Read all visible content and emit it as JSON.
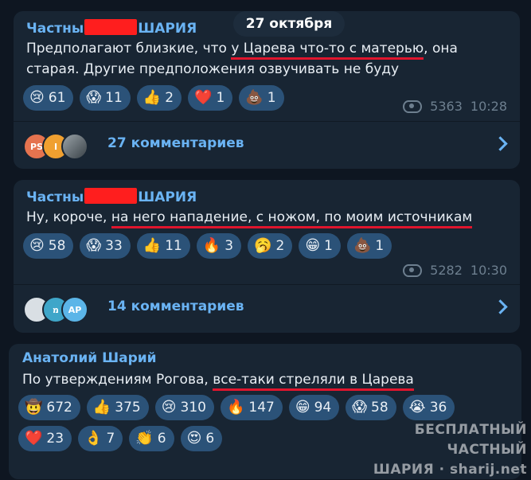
{
  "date_pill": "27 октября",
  "posts": [
    {
      "author_pre": "Частны",
      "author_post": "ШАРИЯ",
      "text_line1_pre": "Предполагают близкие, что ",
      "text_line1_ul": "у Царева что-то с матерью",
      "text_line1_post": ", она",
      "text_line2": "старая. Другие предположения озвучивать не буду",
      "reactions": [
        {
          "icon": "crying-face",
          "emoji": "😢",
          "count": "61"
        },
        {
          "icon": "screaming-face",
          "emoji": "😱",
          "count": "11"
        },
        {
          "icon": "thumbs-up",
          "emoji": "👍",
          "count": "2"
        },
        {
          "icon": "red-heart",
          "emoji": "❤️",
          "count": "1"
        },
        {
          "icon": "pile-of-poo",
          "emoji": "💩",
          "count": "1"
        }
      ],
      "views": "5363",
      "time": "10:28",
      "avatars": [
        "PS",
        "I",
        ""
      ],
      "comments": "27 комментариев"
    },
    {
      "author_pre": "Частны",
      "author_post": "ШАРИЯ",
      "text_line1_pre": "Ну, короче, ",
      "text_line1_ul": "на него нападение, с ножом, по моим источникам",
      "reactions": [
        {
          "icon": "crying-face",
          "emoji": "😢",
          "count": "58"
        },
        {
          "icon": "screaming-face",
          "emoji": "😱",
          "count": "33"
        },
        {
          "icon": "thumbs-up",
          "emoji": "👍",
          "count": "11"
        },
        {
          "icon": "fire",
          "emoji": "🔥",
          "count": "3"
        },
        {
          "icon": "yawning-face",
          "emoji": "🥱",
          "count": "2"
        },
        {
          "icon": "grinning-face",
          "emoji": "😁",
          "count": "1"
        },
        {
          "icon": "pile-of-poo",
          "emoji": "💩",
          "count": "1"
        }
      ],
      "views": "5282",
      "time": "10:30",
      "avatars": [
        "",
        "מ",
        "AP"
      ],
      "comments": "14 комментариев"
    },
    {
      "author": "Анатолий Шарий",
      "text_line1_pre": "По утверждениям Рогова, ",
      "text_line1_ul": "все-таки стреляли в Царева",
      "reactions_row1": [
        {
          "icon": "cowboy-face",
          "emoji": "🤠",
          "count": "672"
        },
        {
          "icon": "thumbs-up",
          "emoji": "👍",
          "count": "375"
        },
        {
          "icon": "crying-face",
          "emoji": "😢",
          "count": "310"
        },
        {
          "icon": "fire",
          "emoji": "🔥",
          "count": "147"
        },
        {
          "icon": "grinning-face",
          "emoji": "😁",
          "count": "94"
        },
        {
          "icon": "screaming-face",
          "emoji": "😱",
          "count": "58"
        },
        {
          "icon": "loudly-crying-face",
          "emoji": "😭",
          "count": "36"
        }
      ],
      "reactions_row2": [
        {
          "icon": "red-heart",
          "emoji": "❤️",
          "count": "23"
        },
        {
          "icon": "ok-hand",
          "emoji": "👌",
          "count": "7"
        },
        {
          "icon": "clapping-hands",
          "emoji": "👏",
          "count": "6"
        },
        {
          "icon": "heart-eyes",
          "emoji": "😍",
          "count": "6"
        }
      ]
    }
  ],
  "watermark_line1": "БЕСПЛАТНЫЙ ЧАСТНЫЙ",
  "watermark_line2": "ШАРИЯ · sharij.net",
  "colors": {
    "background": "#0e1621",
    "bubble": "#182533",
    "accent": "#6ab3f3",
    "reaction_bg": "#2b5278",
    "underline": "#e0152d",
    "redaction": "#ff1e1e"
  }
}
